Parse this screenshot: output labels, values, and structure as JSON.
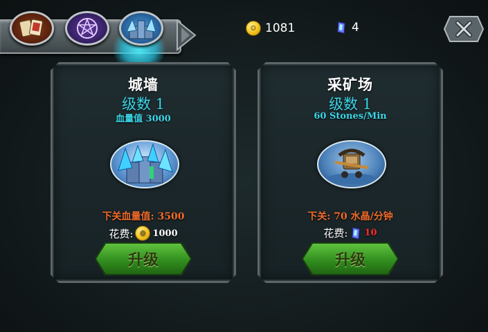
{
  "currencies": {
    "gold": "1081",
    "crystal": "4"
  },
  "cards": [
    {
      "title": "城墙",
      "level": "级数 1",
      "stat": "血量值 3000",
      "next_label": "下关血量值: 3500",
      "cost_label": "花费:",
      "cost_value": "1000",
      "cost_currency": "coin-icon",
      "button_label": "升级"
    },
    {
      "title": "采矿场",
      "level": "级数 1",
      "stat": "60 Stones/Min",
      "next_label": "下关: 70 水晶/分钟",
      "cost_label": "花费:",
      "cost_value": "10",
      "cost_currency": "crystal-icon",
      "button_label": "升级"
    }
  ],
  "colors": {
    "accent_cyan": "#3ad6e8",
    "next_orange": "#f06a2a",
    "button_green": "#3fa52a",
    "cost_red": "#ff2a2a"
  }
}
